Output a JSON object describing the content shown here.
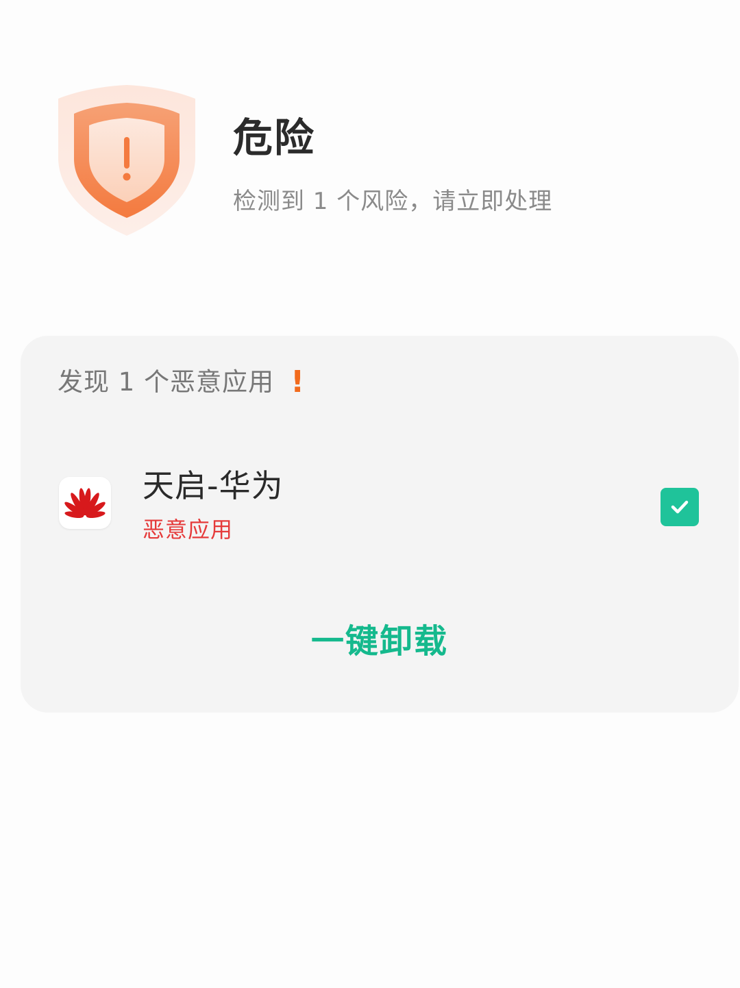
{
  "header": {
    "status_title": "危险",
    "status_desc": "检测到 1 个风险，请立即处理",
    "warn_glyph": "!"
  },
  "card": {
    "heading": "发现 1 个恶意应用",
    "heading_mark": "!",
    "apps": [
      {
        "name": "天启-华为",
        "tag": "恶意应用",
        "icon": "huawei-logo-icon",
        "checked": true
      }
    ],
    "uninstall_label": "一键卸载"
  },
  "colors": {
    "danger_orange": "#f26b1d",
    "tag_red": "#e53a3a",
    "accent_green": "#15b98d",
    "checkbox_green": "#1fc39a",
    "huawei_red": "#d7191c"
  }
}
